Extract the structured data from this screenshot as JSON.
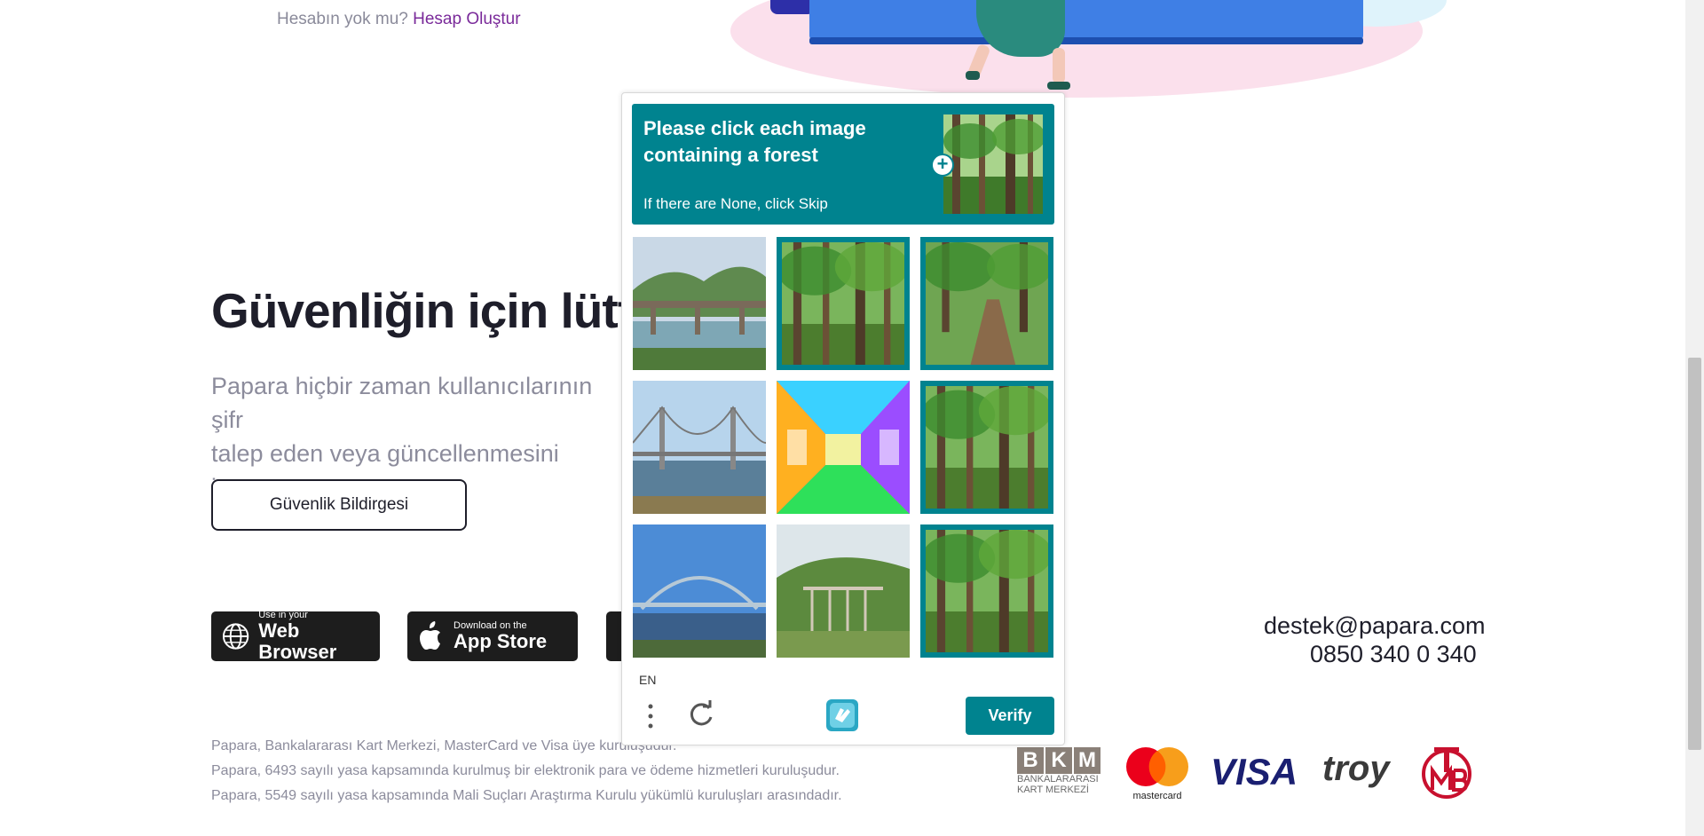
{
  "signup": {
    "prompt": "Hesabın yok mu?",
    "link": "Hesap Oluştur"
  },
  "security": {
    "headline": "Güvenliğin için lütfe",
    "paragraph_line1": "Papara hiçbir zaman kullanıcılarının şifr",
    "paragraph_line2": "talep eden veya güncellenmesini isteye",
    "button": "Güvenlik Bildirgesi"
  },
  "stores": {
    "web_small": "Use in your",
    "web_big": "Web Browser",
    "apple_small": "Download on the",
    "apple_big": "App Store"
  },
  "contact": {
    "email": "destek@papara.com",
    "phone": "0850 340 0 340"
  },
  "legal": [
    "Papara, Bankalararası Kart Merkezi, MasterCard ve Visa üye kuruluşudur.",
    "Papara, 6493 sayılı yasa kapsamında kurulmuş bir elektronik para ve ödeme hizmetleri kuruluşudur.",
    "Papara, 5549 sayılı yasa kapsamında Mali Suçları Araştırma Kurulu yükümlü kuruluşları arasındadır."
  ],
  "partners": {
    "bkm_letters": [
      "B",
      "K",
      "M"
    ],
    "bkm_line1": "BANKALARARASI",
    "bkm_line2": "KART MERKEZİ",
    "mastercard": "mastercard",
    "visa": "VISA",
    "troy": "troy"
  },
  "captcha": {
    "title": "Please click each image containing a forest",
    "subtitle": "If there are None, click Skip",
    "language": "EN",
    "verify": "Verify",
    "tiles": [
      {
        "subject": "bridge over river",
        "selected": false
      },
      {
        "subject": "forest",
        "selected": true
      },
      {
        "subject": "forest path",
        "selected": true
      },
      {
        "subject": "suspension bridge",
        "selected": false
      },
      {
        "subject": "colorful hallway",
        "selected": false
      },
      {
        "subject": "forest",
        "selected": true
      },
      {
        "subject": "arch bridge",
        "selected": false
      },
      {
        "subject": "bridge in valley",
        "selected": false
      },
      {
        "subject": "forest",
        "selected": true
      }
    ],
    "colors": {
      "accent": "#00838f"
    }
  }
}
